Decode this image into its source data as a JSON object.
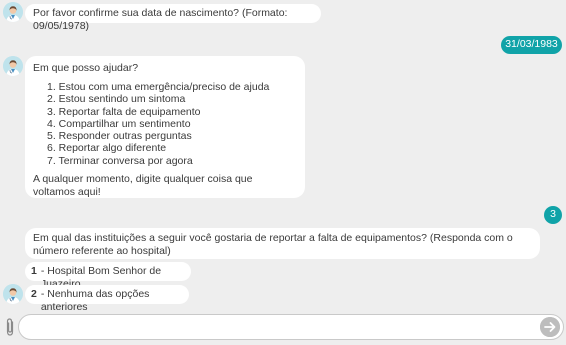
{
  "messages": {
    "bot_dob_prompt": "Por favor confirme sua data de nascimento? (Formato: 09/05/1978)",
    "user_dob": "31/03/1983",
    "bot_menu": {
      "intro": "Em que posso ajudar?",
      "items": [
        "1. Estou com uma emergência/preciso de ajuda",
        "2. Estou sentindo um sintoma",
        "3. Reportar falta de equipamento",
        "4. Compartilhar um sentimento",
        "5. Responder outras perguntas",
        "6. Reportar algo diferente",
        "7. Terminar conversa por agora"
      ],
      "footer": "A qualquer momento, digite qualquer coisa que voltamos aqui!"
    },
    "user_choice": "3",
    "bot_institution_question": "Em qual das instituições a seguir você gostaria de reportar a falta de equipamentos? (Responda com o número referente ao hospital)",
    "options": [
      {
        "number": "1",
        "label": "- Hospital Bom Senhor de Juazeiro"
      },
      {
        "number": "2",
        "label": "- Nenhuma das opções anteriores"
      }
    ]
  },
  "composer": {
    "value": "",
    "placeholder": ""
  },
  "icons": {
    "attach": "paperclip-icon",
    "send": "send-arrow-icon",
    "avatar": "doctor-avatar-icon"
  },
  "colors": {
    "background": "#eeeeee",
    "user_bubble": "#10a3a8",
    "bot_bubble": "#ffffff",
    "send_button": "#bdbdbd"
  }
}
